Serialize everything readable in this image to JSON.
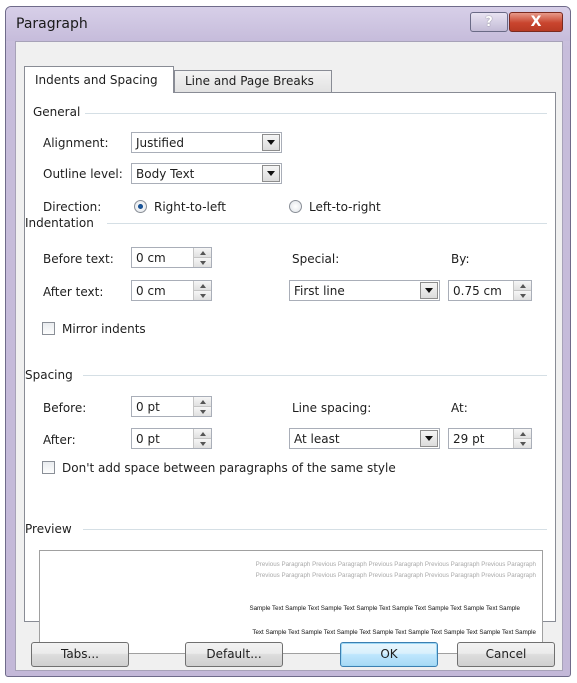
{
  "window": {
    "title": "Paragraph",
    "help_label": "?",
    "close_label": "X"
  },
  "tabs": [
    {
      "label": "Indents and Spacing",
      "active": true
    },
    {
      "label": "Line and Page Breaks",
      "active": false
    }
  ],
  "general": {
    "section_label": "General",
    "alignment_label": "Alignment:",
    "alignment_value": "Justified",
    "outline_label": "Outline level:",
    "outline_value": "Body Text",
    "direction_label": "Direction:",
    "direction_rtl": "Right-to-left",
    "direction_ltr": "Left-to-right",
    "direction_selected": "Right-to-left"
  },
  "indentation": {
    "section_label": "Indentation",
    "before_label": "Before text:",
    "before_value": "0 cm",
    "after_label": "After text:",
    "after_value": "0 cm",
    "special_label": "Special:",
    "special_value": "First line",
    "by_label": "By:",
    "by_value": "0.75 cm",
    "mirror_label": "Mirror indents",
    "mirror_checked": false
  },
  "spacing": {
    "section_label": "Spacing",
    "before_label": "Before:",
    "before_value": "0 pt",
    "after_label": "After:",
    "after_value": "0 pt",
    "line_spacing_label": "Line spacing:",
    "line_spacing_value": "At least",
    "at_label": "At:",
    "at_value": "29 pt",
    "no_space_label": "Don't add space between paragraphs of the same style",
    "no_space_checked": false
  },
  "preview": {
    "section_label": "Preview",
    "previous_line_1": "Previous Paragraph Previous Paragraph Previous Paragraph Previous Paragraph Previous Paragraph",
    "previous_line_2": "Previous Paragraph Previous Paragraph Previous Paragraph Previous Paragraph Previous Paragraph",
    "sample_line_1": "Sample Text Sample Text Sample Text Sample Text Sample Text Sample Text Sample Text Sample",
    "sample_line_2": "Text Sample Text Sample Text Sample Text Sample Text Sample Text Sample Text Sample Text Sample"
  },
  "buttons": {
    "tabs": "Tabs...",
    "default": "Default...",
    "ok": "OK",
    "cancel": "Cancel"
  }
}
